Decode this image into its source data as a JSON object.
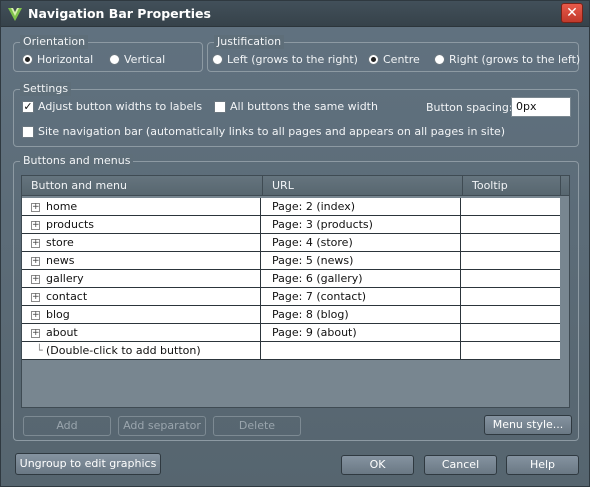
{
  "window": {
    "title": "Navigation Bar Properties",
    "close_label": "✕"
  },
  "orientation": {
    "legend": "Orientation",
    "options": [
      {
        "label": "Horizontal",
        "selected": true
      },
      {
        "label": "Vertical",
        "selected": false
      }
    ]
  },
  "justification": {
    "legend": "Justification",
    "options": [
      {
        "label": "Left (grows to the right)",
        "selected": false
      },
      {
        "label": "Centre",
        "selected": true
      },
      {
        "label": "Right (grows to the left)",
        "selected": false
      }
    ]
  },
  "settings": {
    "legend": "Settings",
    "adjust_widths": {
      "label": "Adjust button widths to labels",
      "checked": true
    },
    "same_width": {
      "label": "All buttons the same width",
      "checked": false
    },
    "spacing_label": "Button spacing:",
    "spacing_value": "0px",
    "site_nav": {
      "label": "Site navigation bar (automatically links to all pages and appears on all pages in site)",
      "checked": false
    }
  },
  "buttons_menus": {
    "legend": "Buttons and menus",
    "columns": [
      "Button and menu",
      "URL",
      "Tooltip"
    ],
    "rows": [
      {
        "name": "home",
        "url": "Page: 2 (index)",
        "tooltip": ""
      },
      {
        "name": "products",
        "url": "Page: 3 (products)",
        "tooltip": ""
      },
      {
        "name": "store",
        "url": "Page: 4 (store)",
        "tooltip": ""
      },
      {
        "name": "news",
        "url": "Page: 5 (news)",
        "tooltip": ""
      },
      {
        "name": "gallery",
        "url": "Page: 6 (gallery)",
        "tooltip": ""
      },
      {
        "name": "contact",
        "url": "Page: 7 (contact)",
        "tooltip": ""
      },
      {
        "name": "blog",
        "url": "Page: 8 (blog)",
        "tooltip": ""
      },
      {
        "name": "about",
        "url": "Page: 9 (about)",
        "tooltip": ""
      }
    ],
    "add_row": "(Double-click to add button)",
    "buttons": {
      "add": "Add",
      "add_separator": "Add separator",
      "delete": "Delete",
      "menu_style": "Menu style..."
    }
  },
  "footer": {
    "ungroup": "Ungroup to edit graphics",
    "ok": "OK",
    "cancel": "Cancel",
    "help": "Help"
  }
}
